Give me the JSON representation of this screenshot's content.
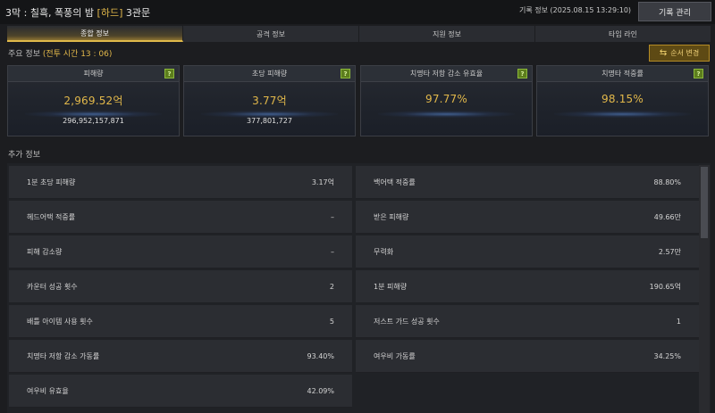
{
  "header": {
    "title_prefix": "3막 : 칠흑, 폭풍의 밤 ",
    "difficulty": "[하드]",
    "title_suffix": " 3관문",
    "record_info": "기록 정보 (2025.08.15 13:29:10)",
    "record_button": "기록 관리"
  },
  "tabs": [
    {
      "label": "종합 정보",
      "active": true
    },
    {
      "label": "공격 정보",
      "active": false
    },
    {
      "label": "지원 정보",
      "active": false
    },
    {
      "label": "타임 라인",
      "active": false
    }
  ],
  "main": {
    "label_prefix": "주요 정보 ",
    "battle_time": "(전투 시간 13 : 06)",
    "order_button": "순서 변경"
  },
  "cards": [
    {
      "title": "피해량",
      "value": "2,969.52억",
      "sub": "296,952,157,871"
    },
    {
      "title": "초당 피해량",
      "value": "3.77억",
      "sub": "377,801,727"
    },
    {
      "title": "치명타 저항 감소 유효율",
      "value": "97.77%",
      "sub": ""
    },
    {
      "title": "치명타 적중률",
      "value": "98.15%",
      "sub": ""
    }
  ],
  "help_glyph": "?",
  "additional": {
    "label": "추가 정보",
    "left": [
      {
        "k": "1분 초당 피해량",
        "v": "3.17억"
      },
      {
        "k": "헤드어택 적중률",
        "v": "–"
      },
      {
        "k": "피해 감소량",
        "v": "–"
      },
      {
        "k": "카운터 성공 횟수",
        "v": "2"
      },
      {
        "k": "배틀 아이템 사용 횟수",
        "v": "5"
      },
      {
        "k": "치명타 저항 감소 가동률",
        "v": "93.40%"
      },
      {
        "k": "여우비 유효율",
        "v": "42.09%"
      }
    ],
    "right": [
      {
        "k": "백어택 적중률",
        "v": "88.80%"
      },
      {
        "k": "받은 피해량",
        "v": "49.66만"
      },
      {
        "k": "무력화",
        "v": "2.57만"
      },
      {
        "k": "1분 피해량",
        "v": "190.65억"
      },
      {
        "k": "저스트 가드 성공 횟수",
        "v": "1"
      },
      {
        "k": "여우비 가동률",
        "v": "34.25%"
      }
    ]
  },
  "colors": {
    "accent": "#e2b84a",
    "background": "#1c1d20",
    "help_green": "#5c7d1d"
  }
}
